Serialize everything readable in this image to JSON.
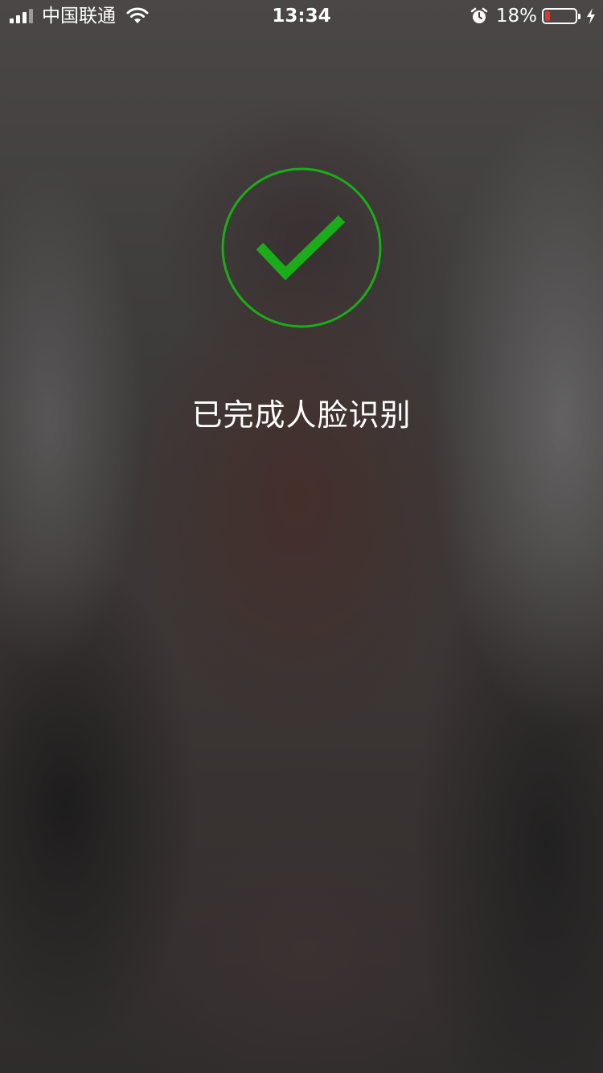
{
  "status_bar": {
    "carrier": "中国联通",
    "time": "13:34",
    "battery_percent": "18%",
    "battery_level": 0.18,
    "icons": [
      "signal-icon",
      "wifi-icon",
      "alarm-icon",
      "battery-icon",
      "charging-icon"
    ]
  },
  "face_recognition": {
    "status_icon": "check-circle-icon",
    "accent_color": "#1aad19",
    "message": "已完成人脸识别"
  }
}
